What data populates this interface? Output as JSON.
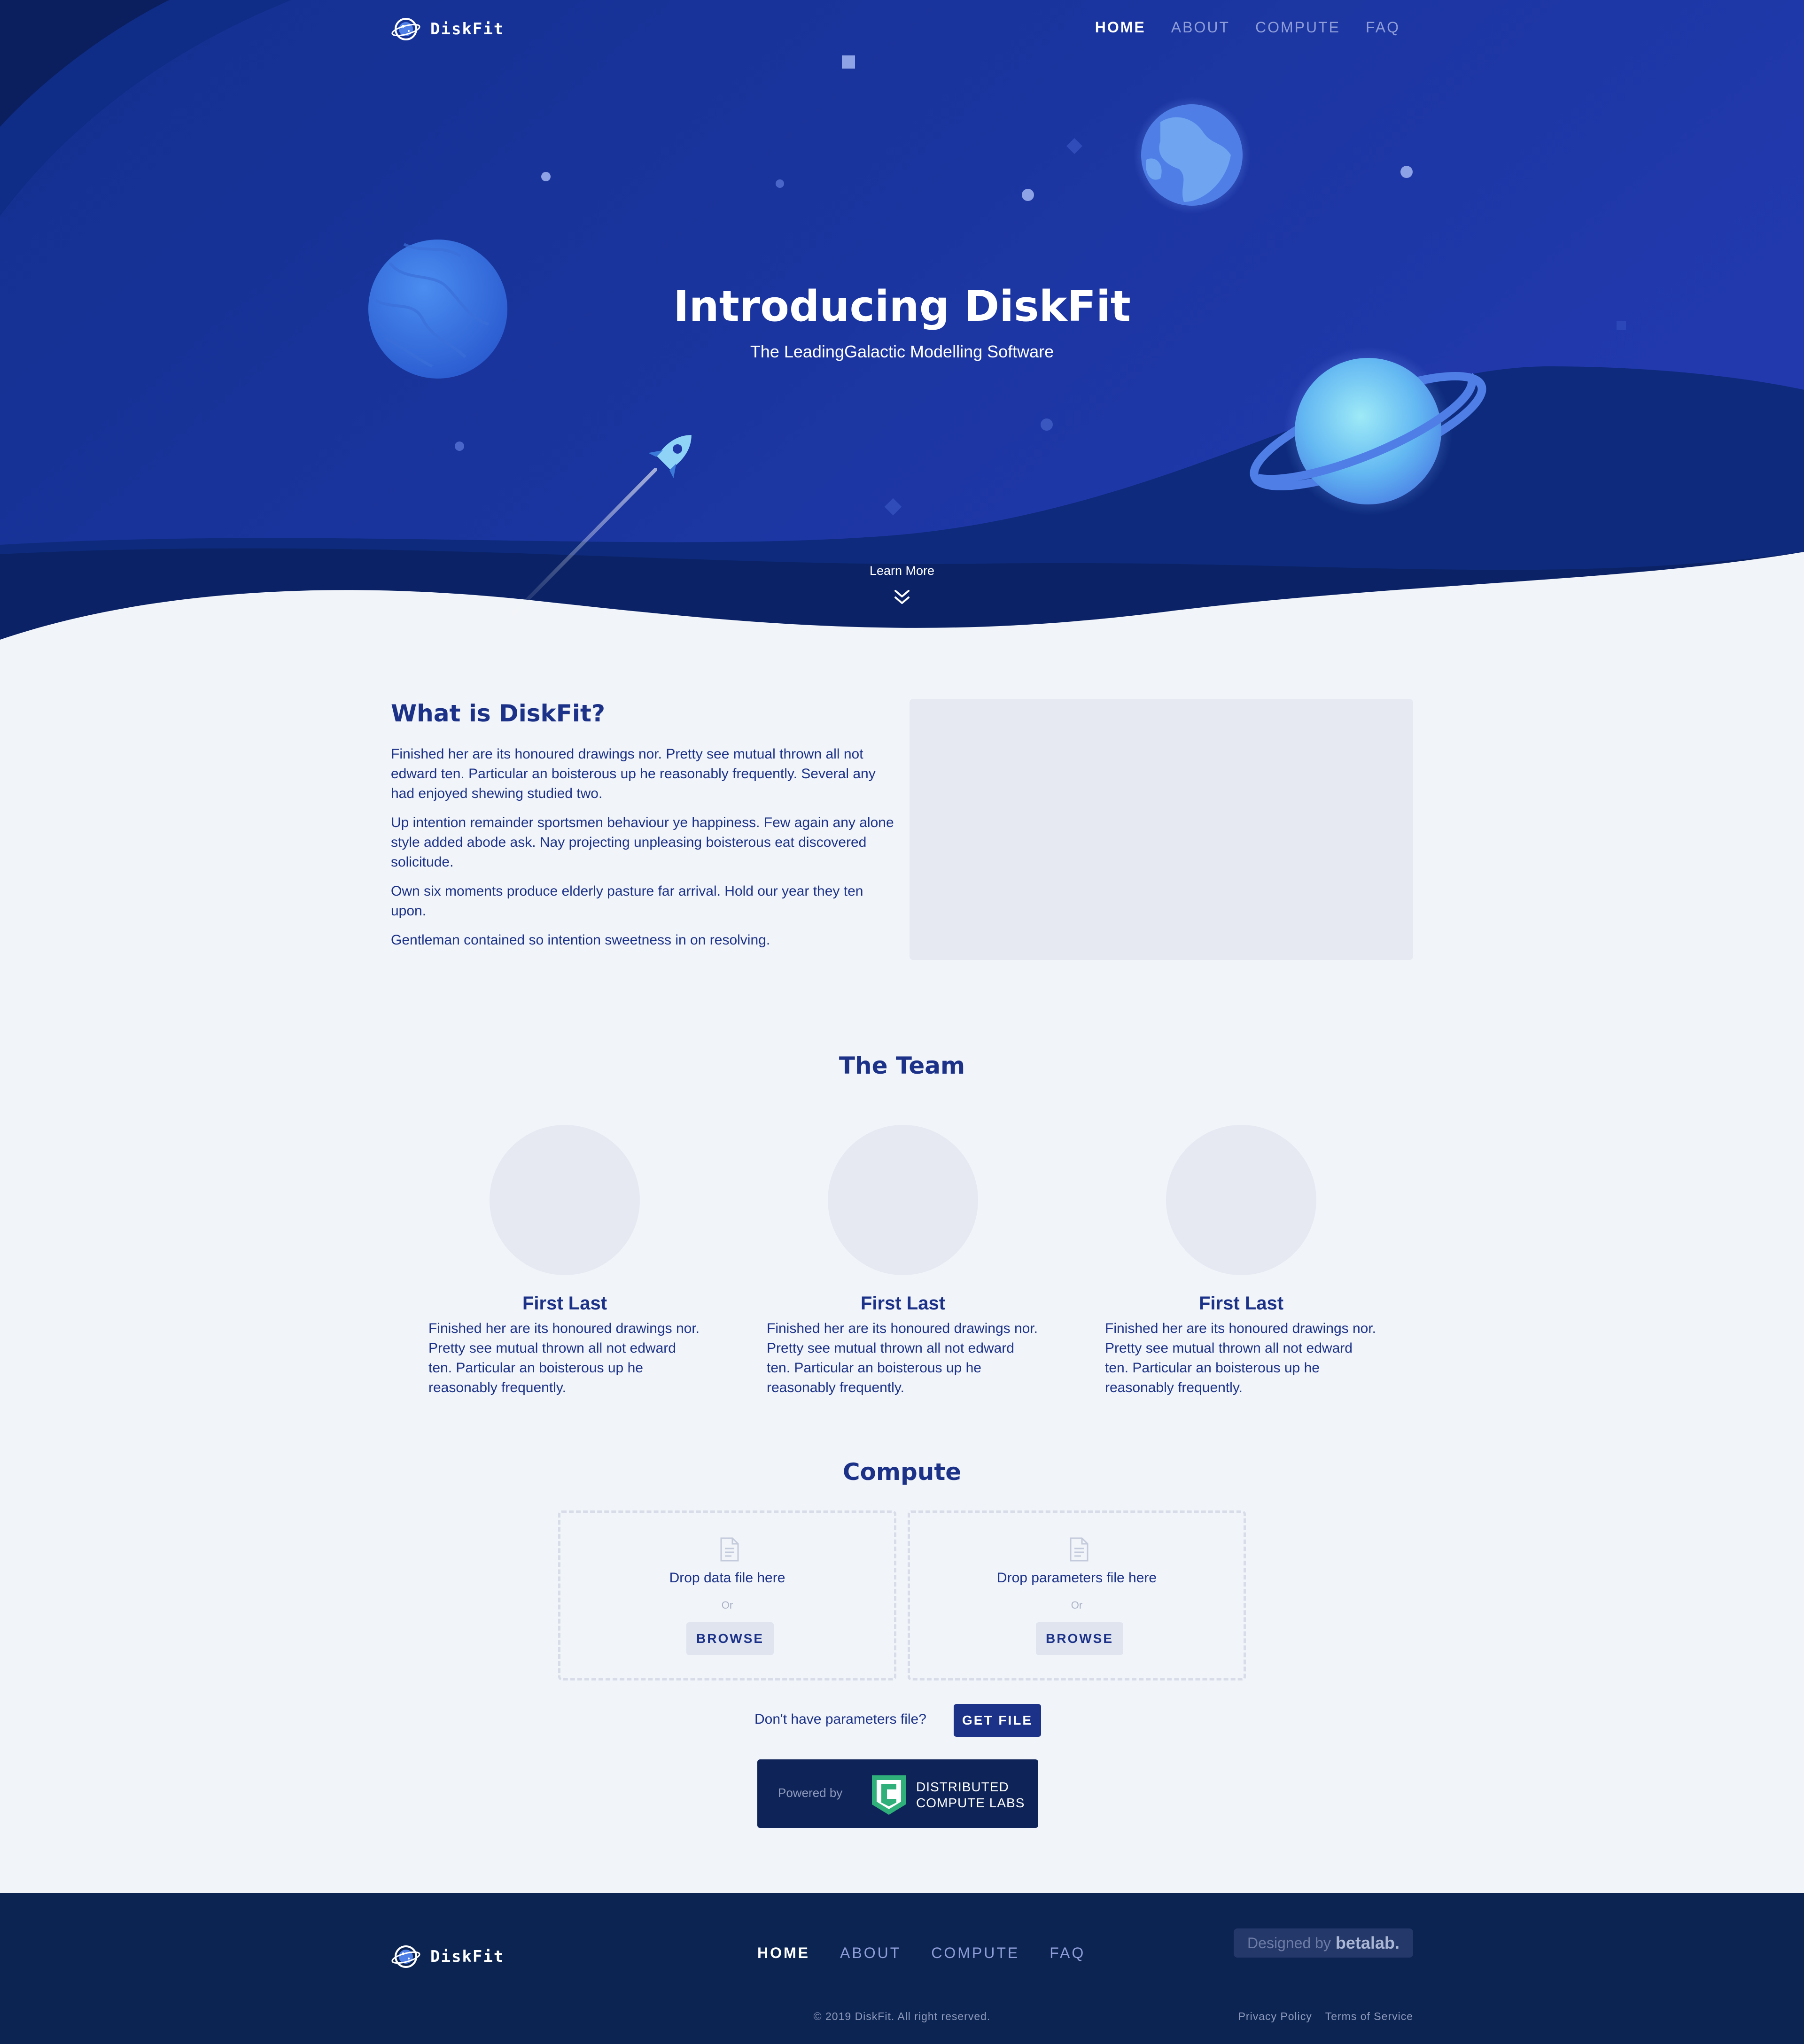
{
  "brand": {
    "name": "DiskFit",
    "icon": "planet-logo-icon"
  },
  "nav": {
    "items": [
      {
        "label": "HOME",
        "active": true
      },
      {
        "label": "ABOUT",
        "active": false
      },
      {
        "label": "COMPUTE",
        "active": false
      },
      {
        "label": "FAQ",
        "active": false
      }
    ]
  },
  "hero": {
    "title": "Introducing DiskFit",
    "subtitle": "The LeadingGalactic Modelling Software",
    "learn_more": "Learn More",
    "learn_more_icon": "double-chevron-down-icon"
  },
  "about": {
    "title": "What is DiskFit?",
    "paragraphs": [
      "Finished her are its honoured drawings nor. Pretty see mutual thrown all not edward ten. Particular an boisterous up he reasonably frequently. Several any had enjoyed shewing studied two.",
      "Up intention remainder sportsmen behaviour ye happiness. Few again any alone style added abode ask. Nay projecting unpleasing boisterous eat discovered solicitude.",
      "Own six moments produce elderly pasture far arrival. Hold our year they ten upon.",
      "Gentleman contained so intention sweetness in on resolving."
    ]
  },
  "team": {
    "title": "The Team",
    "members": [
      {
        "name": "First Last",
        "bio": "Finished her are its honoured drawings nor. Pretty see mutual thrown all not edward ten. Particular an boisterous up he reasonably frequently."
      },
      {
        "name": "First Last",
        "bio": "Finished her are its honoured drawings nor. Pretty see mutual thrown all not edward ten. Particular an boisterous up he reasonably frequently."
      },
      {
        "name": "First Last",
        "bio": "Finished her are its honoured drawings nor. Pretty see mutual thrown all not edward ten. Particular an boisterous up he reasonably frequently."
      }
    ]
  },
  "compute": {
    "title": "Compute",
    "dropzones": [
      {
        "text": "Drop data file here",
        "or": "Or",
        "button": "BROWSE",
        "icon": "document-icon"
      },
      {
        "text": "Drop parameters file here",
        "or": "Or",
        "button": "BROWSE",
        "icon": "document-icon"
      }
    ],
    "no_params_text": "Don't have parameters file?",
    "get_file_button": "GET FILE",
    "powered_by": {
      "label": "Powered by",
      "line1": "DISTRIBUTED",
      "line2": "COMPUTE LABS",
      "icon": "distributed-compute-labs-logo"
    }
  },
  "footer": {
    "brand": "DiskFit",
    "nav": [
      "HOME",
      "ABOUT",
      "COMPUTE",
      "FAQ"
    ],
    "designed_label": "Designed by",
    "designed_brand": "betalab.",
    "copyright": "© 2019 DiskFit. All right reserved.",
    "links": [
      "Privacy Policy",
      "Terms of Service"
    ]
  },
  "colors": {
    "hero_top": "#1f38a8",
    "hero_dark": "#0c2a7a",
    "accent": "#1c3289",
    "page_bg": "#f1f4f8",
    "footer_bg": "#0c2452"
  }
}
